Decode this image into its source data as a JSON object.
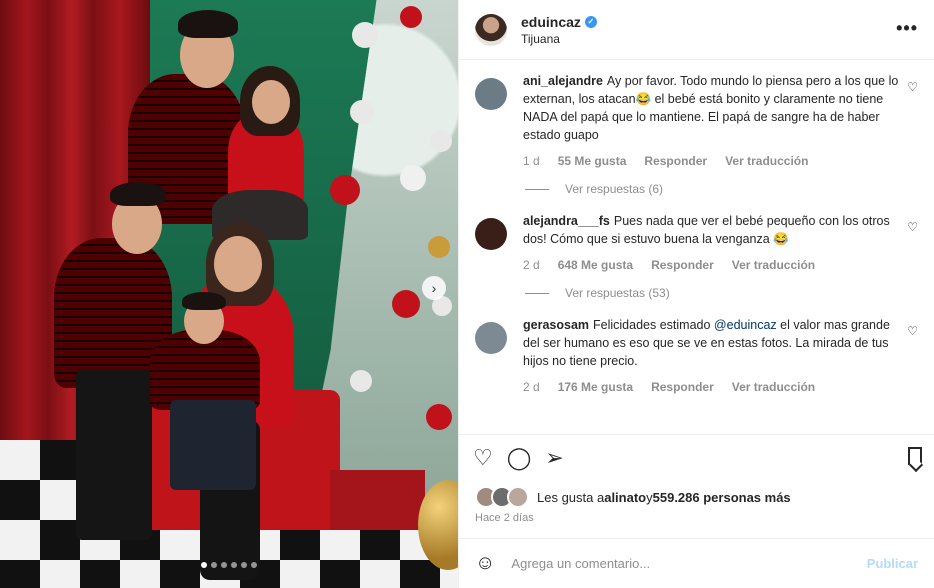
{
  "post": {
    "owner": {
      "username": "eduincaz",
      "location": "Tijuana",
      "verified_icon": "verified-badge-icon"
    },
    "more_label": "•••",
    "carousel": {
      "slides": 6,
      "active": 1
    }
  },
  "comments": [
    {
      "username": "ani_alejandre",
      "text": "Ay por favor. Todo mundo lo piensa pero a los que lo externan, los atacan😂 el bebé está bonito y claramente no tiene NADA del papá que lo mantiene. El papá de sangre ha de haber estado guapo",
      "age": "1 d",
      "likes": "55 Me gusta",
      "reply": "Responder",
      "translate": "Ver traducción",
      "view_replies": "Ver respuestas (6)",
      "avatar_color": "#6b7c86"
    },
    {
      "username": "alejandra___fs",
      "text": "Pues nada que ver el bebé pequeño con los otros dos! Cómo que si estuvo buena la venganza 😂",
      "age": "2 d",
      "likes": "648 Me gusta",
      "reply": "Responder",
      "translate": "Ver traducción",
      "view_replies": "Ver respuestas (53)",
      "avatar_color": "#3a1f18"
    },
    {
      "username": "gerasosam",
      "text_before": "Felicidades estimado ",
      "mention": "@eduincaz",
      "text_after": " el valor mas grande del ser humano es eso que se ve en estas fotos. La mirada de tus hijos no tiene precio.",
      "age": "2 d",
      "likes": "176 Me gusta",
      "reply": "Responder",
      "translate": "Ver traducción",
      "avatar_color": "#7d8a93"
    }
  ],
  "likes_summary": {
    "prefix": "Les gusta a ",
    "user": "alinato",
    "middle": " y ",
    "count": "559.286 personas más"
  },
  "time": "Hace 2 días",
  "add_comment": {
    "placeholder": "Agrega un comentario...",
    "publish": "Publicar"
  },
  "icons": {
    "heart": "heart-icon",
    "comment": "comment-icon",
    "share": "share-icon",
    "save": "bookmark-icon",
    "emoji": "emoji-icon"
  }
}
